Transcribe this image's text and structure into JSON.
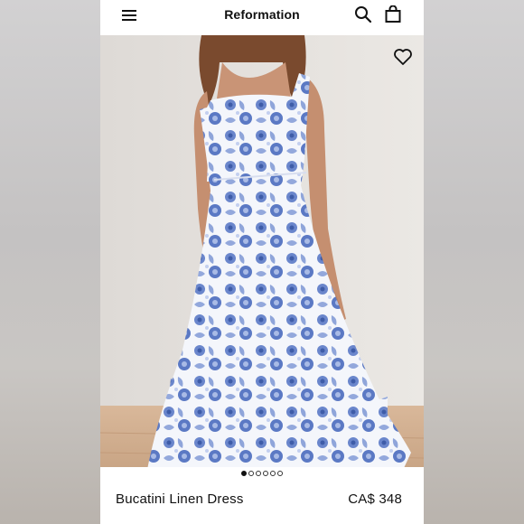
{
  "header": {
    "brand": "Reformation",
    "menu_icon": "hamburger-menu-icon",
    "search_icon": "search-icon",
    "bag_icon": "shopping-bag-icon"
  },
  "hero": {
    "favorite_icon": "heart-outline-icon",
    "image_subject": "floral linen midi dress on model"
  },
  "carousel": {
    "total": 6,
    "active_index": 0
  },
  "product": {
    "name": "Bucatini Linen Dress",
    "price": "CA$ 348"
  },
  "colors": {
    "print_blue": "#5b79c4",
    "background": "#ffffff",
    "text": "#111111"
  }
}
